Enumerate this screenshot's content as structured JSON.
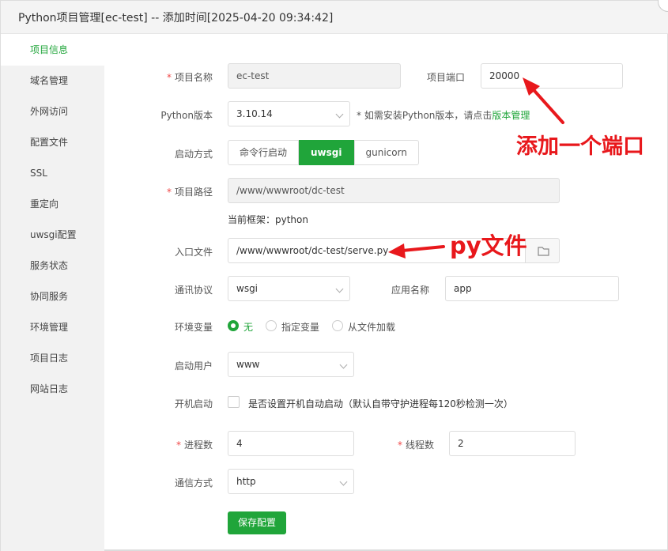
{
  "window": {
    "title": "Python项目管理[ec-test] -- 添加时间[2025-04-20 09:34:42]"
  },
  "sidebar": {
    "items": [
      {
        "label": "项目信息"
      },
      {
        "label": "域名管理"
      },
      {
        "label": "外网访问"
      },
      {
        "label": "配置文件"
      },
      {
        "label": "SSL"
      },
      {
        "label": "重定向"
      },
      {
        "label": "uwsgi配置"
      },
      {
        "label": "服务状态"
      },
      {
        "label": "协同服务"
      },
      {
        "label": "环境管理"
      },
      {
        "label": "项目日志"
      },
      {
        "label": "网站日志"
      }
    ]
  },
  "form": {
    "project_name_label": "项目名称",
    "project_name_value": "ec-test",
    "project_port_label": "项目端口",
    "project_port_value": "20000",
    "python_version_label": "Python版本",
    "python_version_value": "3.10.14",
    "python_version_note": "* 如需安装Python版本，请点击",
    "version_manage_link": "版本管理",
    "start_mode_label": "启动方式",
    "start_modes": [
      "命令行启动",
      "uwsgi",
      "gunicorn"
    ],
    "project_path_label": "项目路径",
    "project_path_value": "/www/wwwroot/dc-test",
    "framework_note": "当前框架：python",
    "entry_file_label": "入口文件",
    "entry_file_value": "/www/wwwroot/dc-test/serve.py",
    "protocol_label": "通讯协议",
    "protocol_value": "wsgi",
    "app_name_label": "应用名称",
    "app_name_value": "app",
    "env_label": "环境变量",
    "env_options": [
      "无",
      "指定变量",
      "从文件加载"
    ],
    "start_user_label": "启动用户",
    "start_user_value": "www",
    "autostart_label": "开机启动",
    "autostart_text": "是否设置开机自动启动（默认自带守护进程每120秒检测一次）",
    "process_label": "进程数",
    "process_value": "4",
    "thread_label": "线程数",
    "thread_value": "2",
    "comm_label": "通信方式",
    "comm_value": "http",
    "save_label": "保存配置"
  },
  "annotations": {
    "port_note": "添加一个端口",
    "py_note": "py文件"
  },
  "colors": {
    "accent": "#20a53a",
    "annotation": "#e8181c",
    "required": "#f04848"
  }
}
